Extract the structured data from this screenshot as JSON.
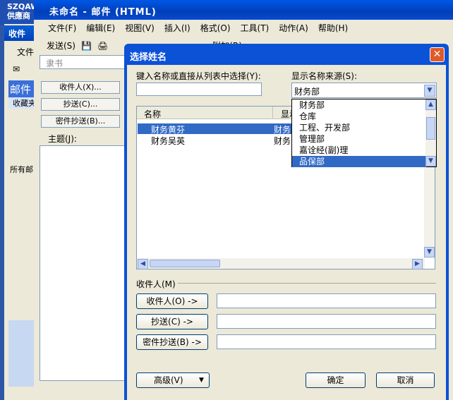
{
  "desktop": {
    "title_line1": "SZQAWI",
    "title_line2": "供應商"
  },
  "outlook": {
    "title": "收件",
    "menu_file": "文件",
    "mail_pane": "邮件",
    "favorites": "收藏夹",
    "all_mail": "所有邮"
  },
  "compose": {
    "title": "未命名 - 邮件 (HTML)",
    "menu": [
      "文件(F)",
      "编辑(E)",
      "视图(V)",
      "插入(I)",
      "格式(O)",
      "工具(T)",
      "动作(A)",
      "帮助(H)"
    ],
    "send": "发送(S)",
    "attach": "附加(R)",
    "account": "隶书",
    "to_btn": "收件人(X)...",
    "cc_btn": "抄送(C)...",
    "bcc_btn": "密件抄送(B)...",
    "subject": "主题(J):"
  },
  "dialog": {
    "title": "选择姓名",
    "search_label": "键入名称或直接从列表中选择(Y):",
    "search_value": "",
    "source_label": "显示名称来源(S):",
    "source_value": "财务部",
    "source_options": [
      "财务部",
      "仓库",
      "工程、开发部",
      "管理部",
      "嘉诠经(副)理",
      "品保部"
    ],
    "source_selected": 5,
    "col_name": "名称",
    "col_display": "显示",
    "rows": [
      {
        "name": "财务黄芬",
        "display": "财务"
      },
      {
        "name": "财务吴英",
        "display": "财务"
      }
    ],
    "selected_row": 0,
    "recipients_label": "收件人(M)",
    "to_btn": "收件人(O) ->",
    "cc_btn": "抄送(C) ->",
    "bcc_btn": "密件抄送(B) ->",
    "to_value": "",
    "cc_value": "",
    "bcc_value": "",
    "advanced_btn": "高级(V)",
    "ok_btn": "确定",
    "cancel_btn": "取消"
  },
  "colors": {
    "title_blue": "#0b52d6",
    "select_blue": "#316ac5",
    "close_red": "#e05a2a"
  }
}
